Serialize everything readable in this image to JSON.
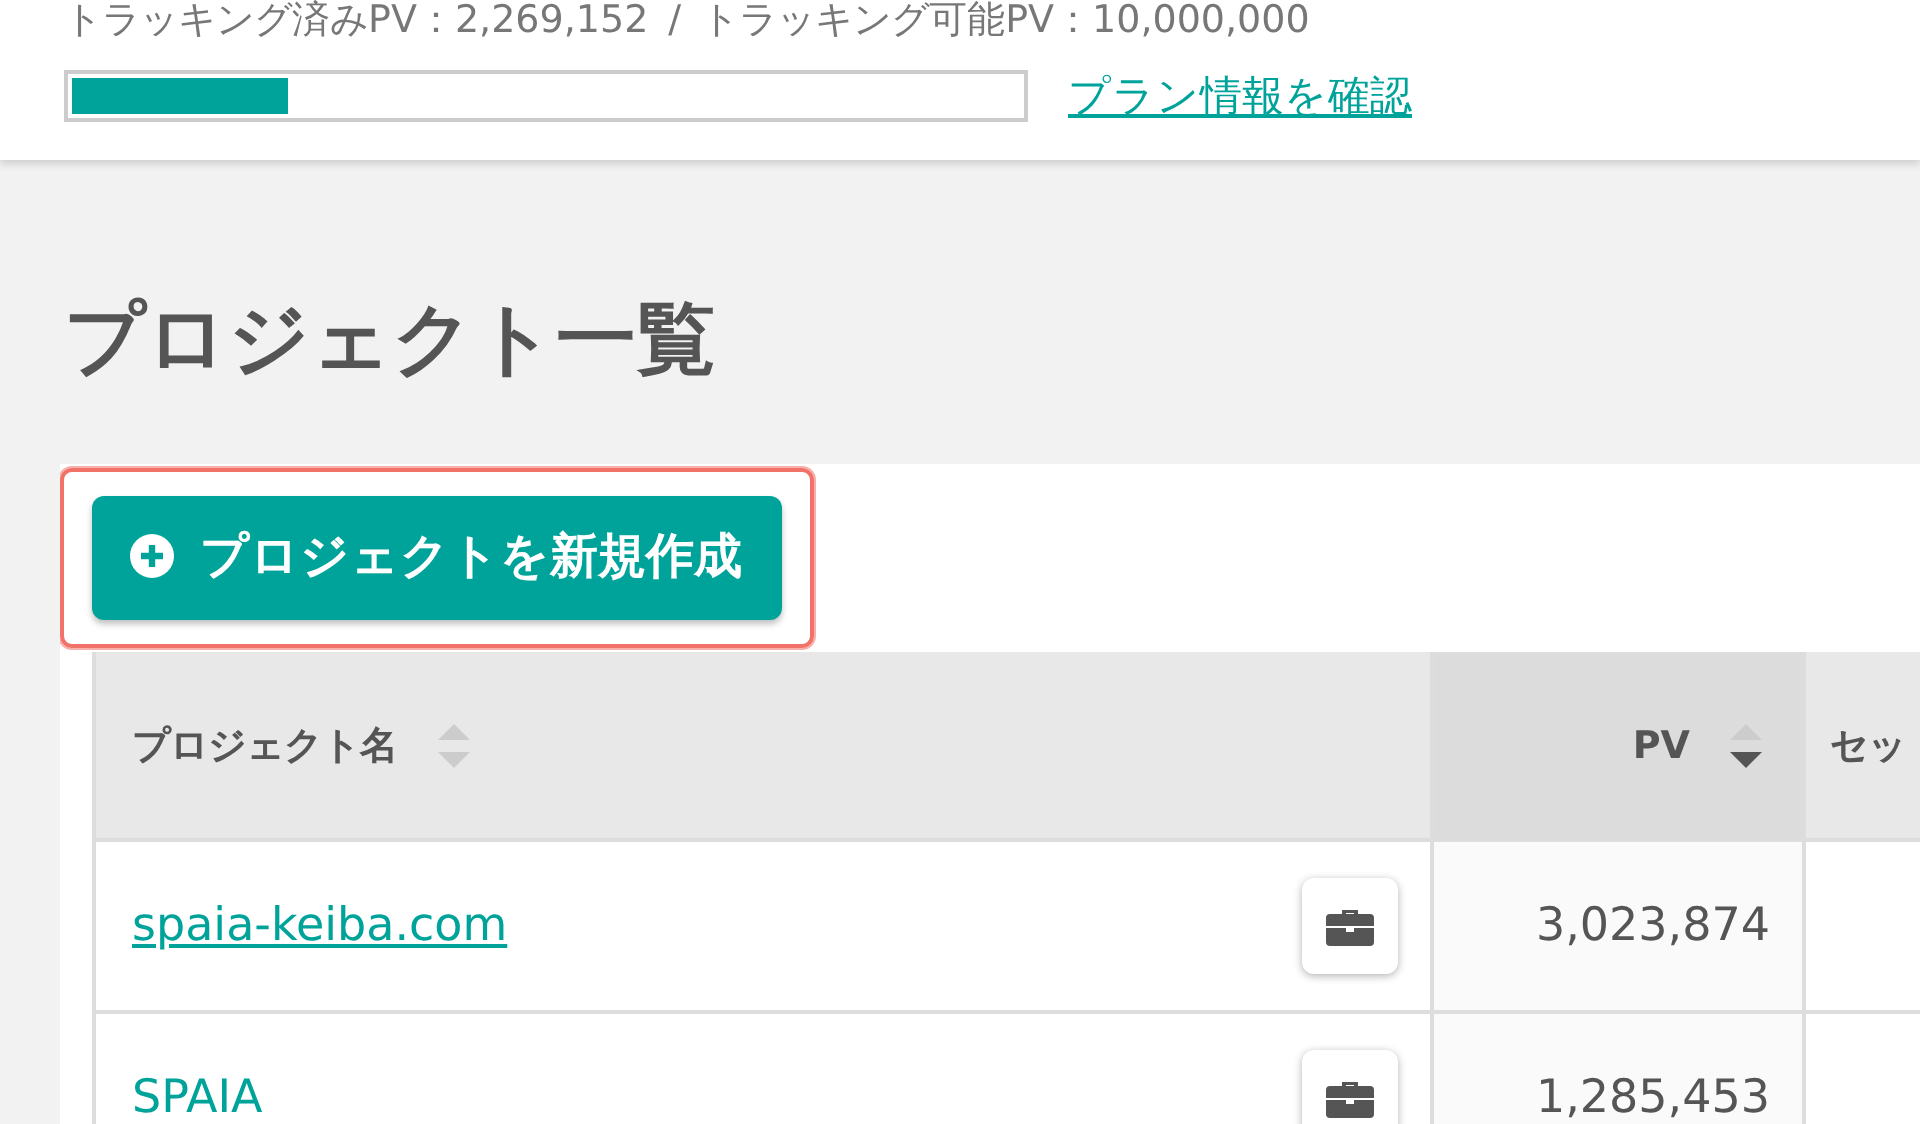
{
  "usage": {
    "tracked_label": "トラッキング済みPV：2,269,152",
    "separator": "/",
    "capacity_label": "トラッキング可能PV：10,000,000",
    "level": 0.227,
    "plan_link": "プラン情報を確認"
  },
  "page_title": "プロジェクト一覧",
  "create_button": {
    "label": "プロジェクトを新規作成",
    "highlighted": true
  },
  "table": {
    "columns": [
      {
        "label": "プロジェクト名",
        "sorted_desc": false
      },
      {
        "label": "PV",
        "sorted_desc": true
      },
      {
        "label": "セッ"
      }
    ],
    "rows": [
      {
        "name": "spaia-keiba.com",
        "underlined": true,
        "pv": "3,023,874"
      },
      {
        "name": "SPAIA",
        "underlined": false,
        "pv": "1,285,453"
      }
    ]
  }
}
